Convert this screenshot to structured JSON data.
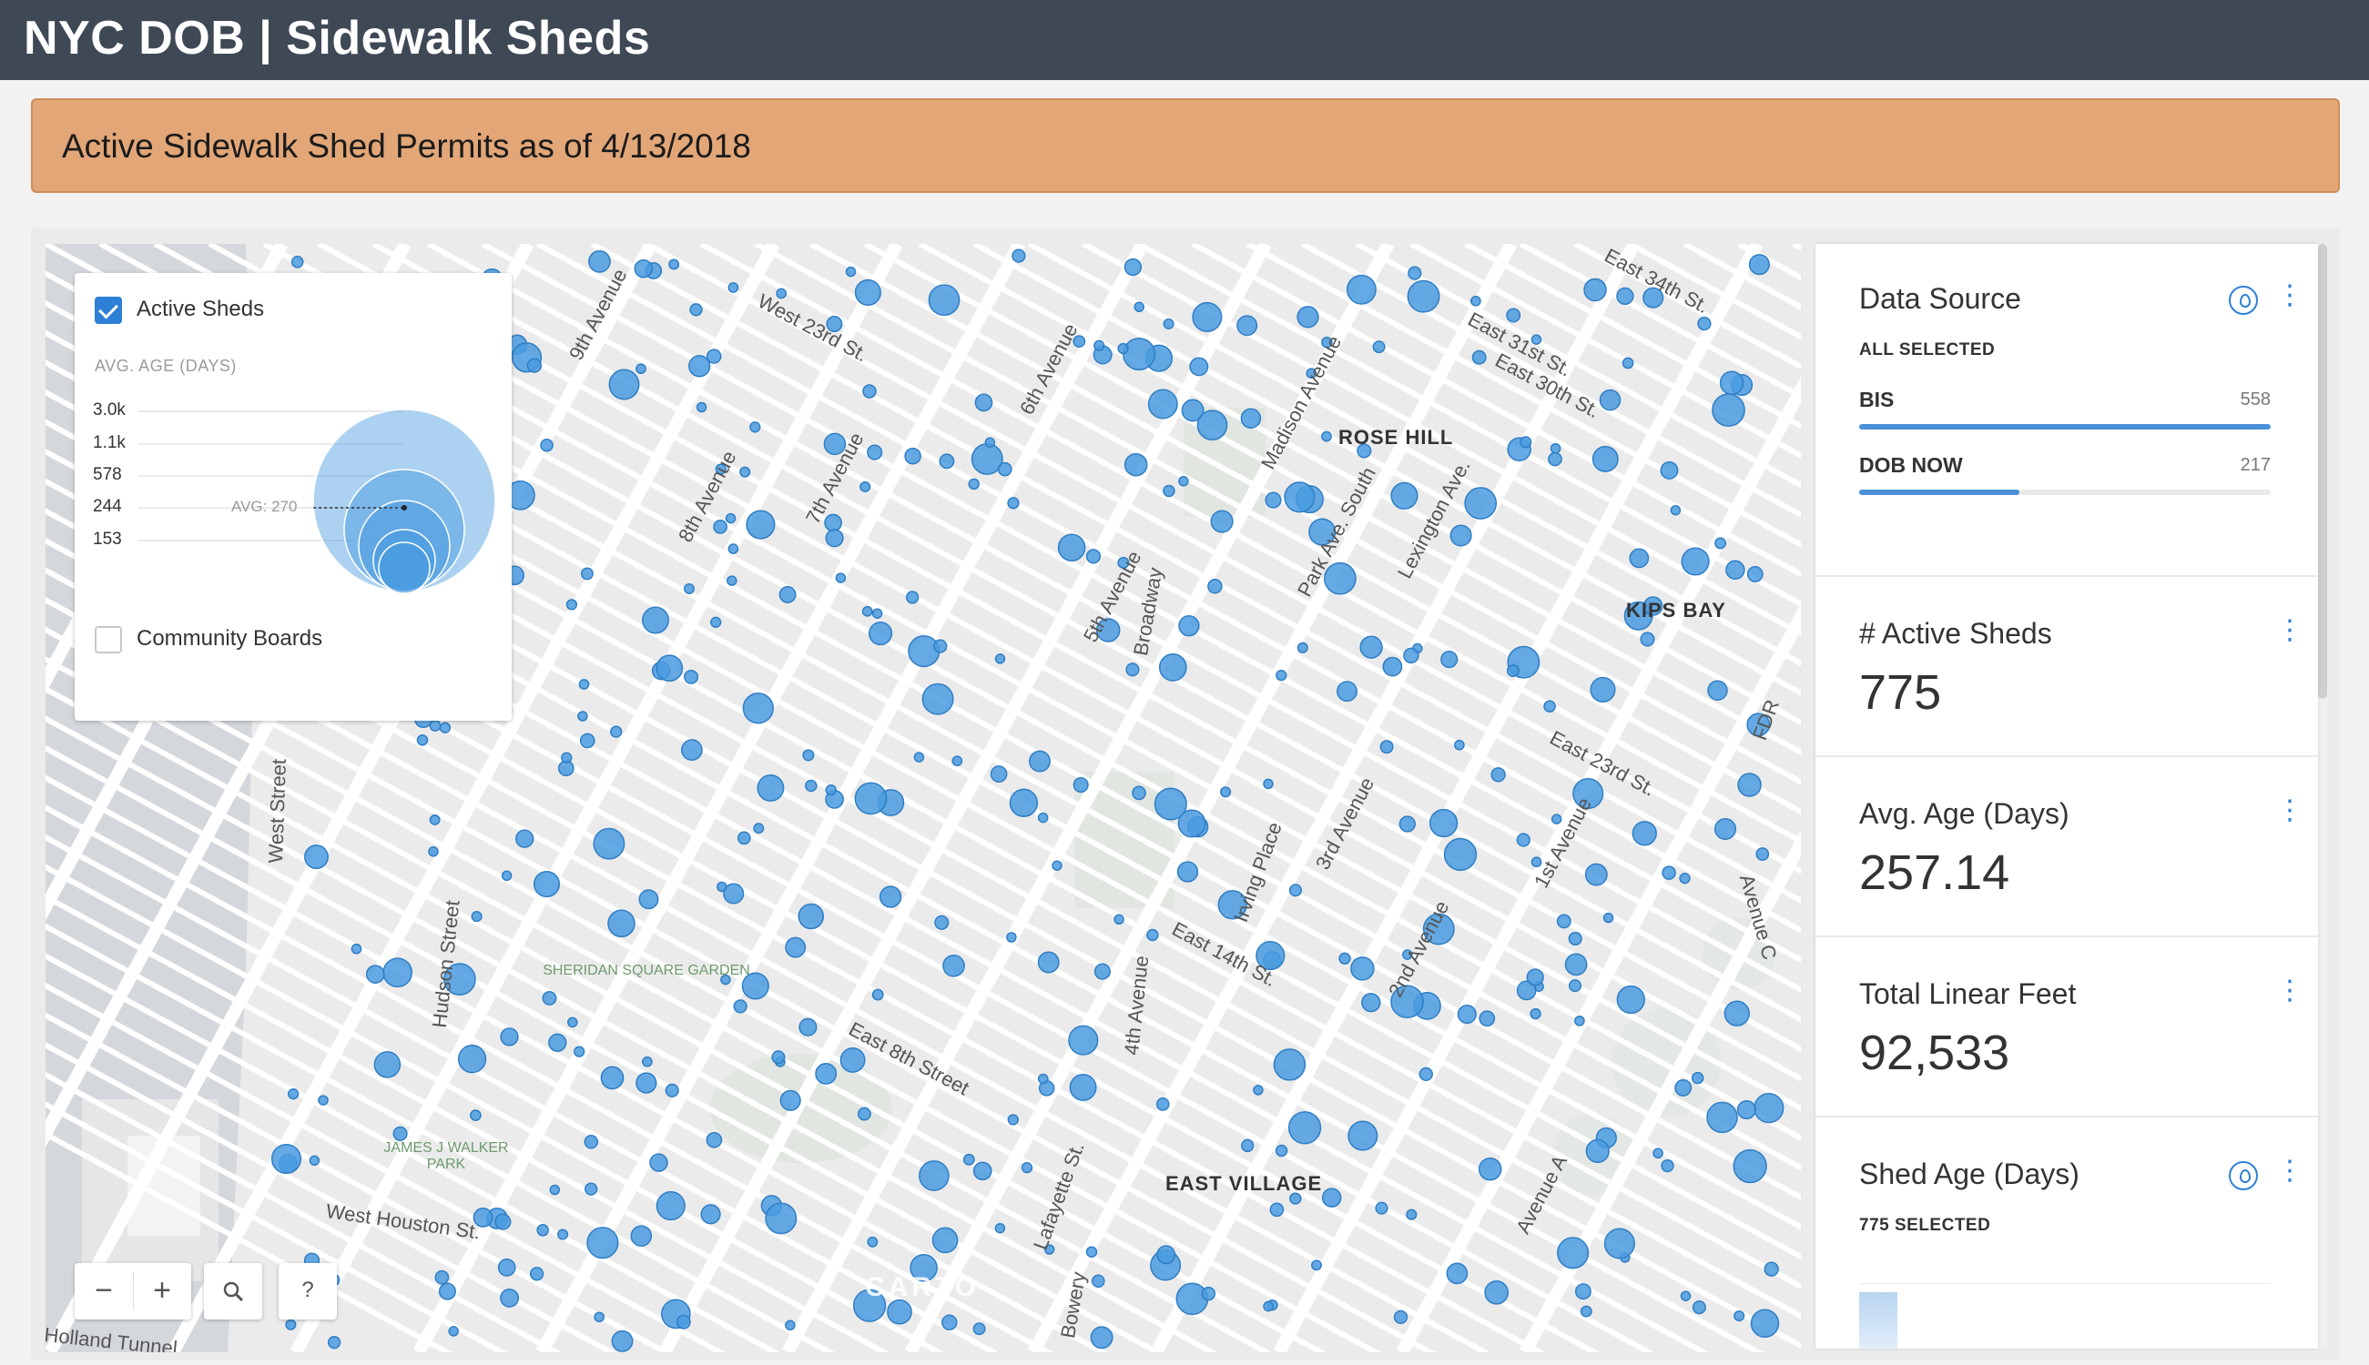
{
  "app": {
    "title": "NYC DOB | Sidewalk Sheds"
  },
  "banner": {
    "text": "Active Sidewalk Shed Permits as of 4/13/2018"
  },
  "colors": {
    "header": "#3f4855",
    "banner": "#e2a677",
    "accent": "#2e7fd6",
    "bubble": "#4a9be0"
  },
  "legend": {
    "layers": [
      {
        "label": "Active Sheds",
        "checked": true
      },
      {
        "label": "Community Boards",
        "checked": false
      }
    ],
    "size_title": "AVG. AGE (DAYS)",
    "size_ticks": [
      "3.0k",
      "1.1k",
      "578",
      "244",
      "153"
    ],
    "avg_label": "AVG: 270"
  },
  "map": {
    "neighborhoods": [
      "ROSE HILL",
      "KIPS BAY",
      "EAST VILLAGE"
    ],
    "parks": [
      "SHERIDAN SQUARE GARDEN",
      "JAMES J WALKER PARK"
    ],
    "roads": [
      "9th Avenue",
      "8th Avenue",
      "7th Avenue",
      "6th Avenue",
      "5th Avenue",
      "Broadway",
      "Madison Avenue",
      "Park Ave. South",
      "Lexington Ave.",
      "3rd Avenue",
      "2nd Avenue",
      "1st Avenue",
      "West 23rd St.",
      "East 23rd St.",
      "East 14th St.",
      "East 8th Street",
      "West Houston St.",
      "West Street",
      "Hudson Street",
      "Irving Place",
      "Lafayette St.",
      "4th Avenue",
      "Avenue A",
      "Avenue C",
      "East 34th St.",
      "East 30th St.",
      "East 31st St.",
      "FDR",
      "Bowery",
      "Holland Tunnel"
    ],
    "watermark": "CARTO",
    "controls": {
      "zoom_out": "−",
      "zoom_in": "+",
      "search_icon": "search-icon",
      "help": "?"
    }
  },
  "widgets": {
    "data_source": {
      "title": "Data Source",
      "status": "ALL SELECTED",
      "categories": [
        {
          "label": "BIS",
          "count": "558",
          "fraction": 1.0
        },
        {
          "label": "DOB NOW",
          "count": "217",
          "fraction": 0.389
        }
      ]
    },
    "active_sheds": {
      "title": "# Active Sheds",
      "value": "775"
    },
    "avg_age": {
      "title": "Avg. Age (Days)",
      "value": "257.14"
    },
    "linear_feet": {
      "title": "Total Linear Feet",
      "value": "92,533"
    },
    "shed_age": {
      "title": "Shed Age (Days)",
      "status": "775 SELECTED"
    }
  }
}
